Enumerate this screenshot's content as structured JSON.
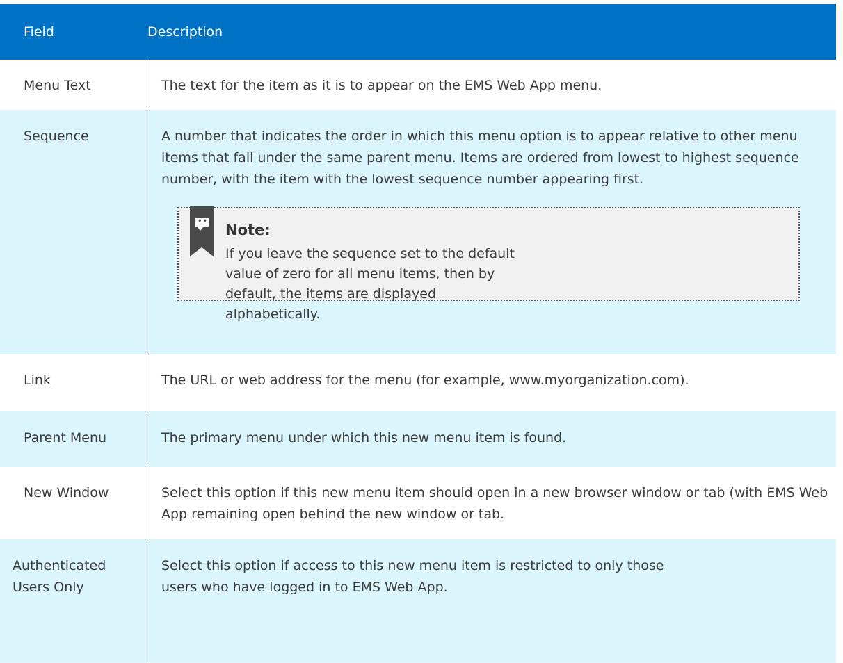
{
  "header": {
    "field": "Field",
    "description": "Description"
  },
  "rows": [
    {
      "field": "Menu Text",
      "description": "The text for the item as it is to appear on the EMS Web App menu."
    },
    {
      "field": "Sequence",
      "description": "A number that indicates the order in which this menu option is to appear relative to other menu items that fall under the same parent menu. Items are ordered from lowest to highest sequence number, with the item with the lowest sequence number appearing first.",
      "note": {
        "title": "Note:",
        "body": "If you leave the sequence set to the default value of zero for all menu items, then by default, the items are displayed alphabetically."
      }
    },
    {
      "field": "Link",
      "description": "The URL or web address for the menu (for example, www.myorganization.com)."
    },
    {
      "field": "Parent Menu",
      "description": "The primary menu under which this new menu item is found."
    },
    {
      "field": "New Window",
      "description": "Select this option if this new menu item should open in a new browser window or tab (with EMS Web App remaining open behind the new window or tab."
    },
    {
      "field": "Authenticated Users Only",
      "description": "Select this option if access to this new menu item is restricted to only those users who have logged in to EMS Web App."
    }
  ],
  "colors": {
    "header_bg": "#0072c6",
    "alt_row_bg": "#daf5fb",
    "note_bg": "#f1f1f1",
    "note_icon": "#4a4a4a"
  },
  "icons": {
    "note": "note-speech-bubble-icon"
  }
}
